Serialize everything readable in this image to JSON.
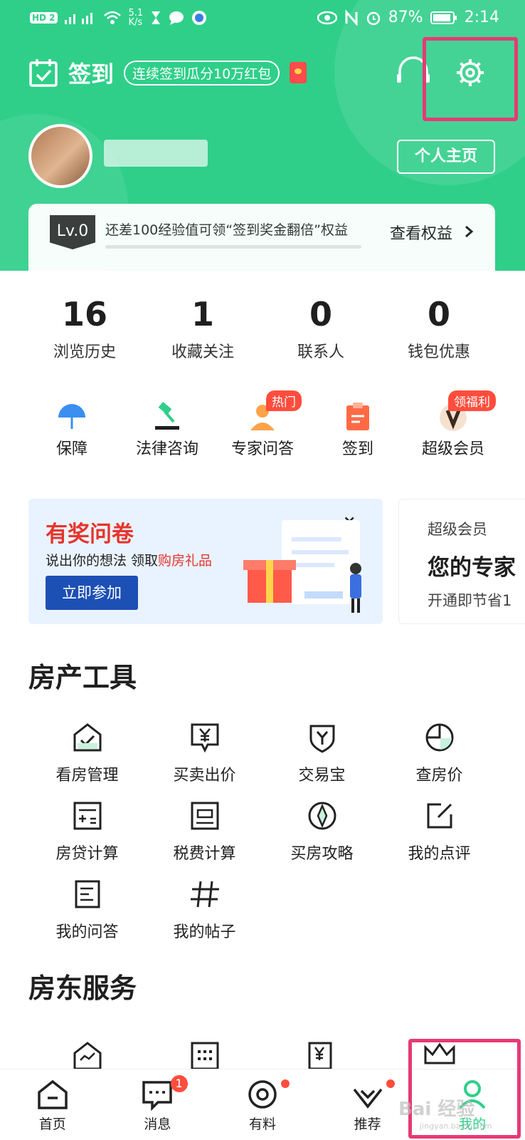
{
  "status_bar": {
    "left_text": "5.1\nK/s",
    "battery": "87%",
    "time": "2:14"
  },
  "header": {
    "title": "签到",
    "promo": "连续签到瓜分10万红包",
    "profile_button": "个人主页",
    "level": "Lv.0",
    "level_hint": "还差100经验值可领“签到奖金翻倍”权益",
    "level_link": "查看权益",
    "level_progress": 0,
    "bg_color": "#2fcf89"
  },
  "stats": [
    {
      "value": "16",
      "label": "浏览历史"
    },
    {
      "value": "1",
      "label": "收藏关注"
    },
    {
      "value": "0",
      "label": "联系人"
    },
    {
      "value": "0",
      "label": "钱包优惠"
    }
  ],
  "quick": [
    {
      "label": "保障",
      "icon": "umbrella-icon",
      "badge": ""
    },
    {
      "label": "法律咨询",
      "icon": "gavel-icon",
      "badge": ""
    },
    {
      "label": "专家问答",
      "icon": "expert-icon",
      "badge": "热门"
    },
    {
      "label": "签到",
      "icon": "clipboard-icon",
      "badge": ""
    },
    {
      "label": "超级会员",
      "icon": "vip-icon",
      "badge": "领福利"
    }
  ],
  "banner": {
    "title": "有奖问卷",
    "subtitle": "说出你的想法 领取",
    "subtitle_highlight": "购房礼品",
    "button": "立即参加",
    "close": "×"
  },
  "vip_card": {
    "title": "超级会员",
    "headline": "您的专家",
    "desc": "开通即节省1"
  },
  "tools_section": {
    "title": "房产工具",
    "items": [
      {
        "label": "看房管理",
        "icon": "house-check-icon"
      },
      {
        "label": "买卖出价",
        "icon": "yen-tag-icon"
      },
      {
        "label": "交易宝",
        "icon": "shield-icon"
      },
      {
        "label": "查房价",
        "icon": "pie-icon"
      },
      {
        "label": "房贷计算",
        "icon": "calculator-icon"
      },
      {
        "label": "税费计算",
        "icon": "tax-icon"
      },
      {
        "label": "买房攻略",
        "icon": "compass-icon"
      },
      {
        "label": "我的点评",
        "icon": "edit-icon"
      },
      {
        "label": "我的问答",
        "icon": "qa-icon"
      },
      {
        "label": "我的帖子",
        "icon": "hash-icon"
      }
    ]
  },
  "landlord_section": {
    "title": "房东服务"
  },
  "nav": [
    {
      "label": "首页",
      "icon": "home-icon"
    },
    {
      "label": "消息",
      "icon": "message-icon",
      "badge": "1"
    },
    {
      "label": "有料",
      "icon": "target-icon"
    },
    {
      "label": "推荐",
      "icon": "heart-check-icon"
    },
    {
      "label": "我的",
      "icon": "person-icon"
    }
  ],
  "watermark": {
    "main": "Bai 经验",
    "sub": "jingyan.baidu.com"
  },
  "colors": {
    "accent": "#2fcf89",
    "highlight": "#e63a74",
    "red": "#ff4d3d"
  }
}
